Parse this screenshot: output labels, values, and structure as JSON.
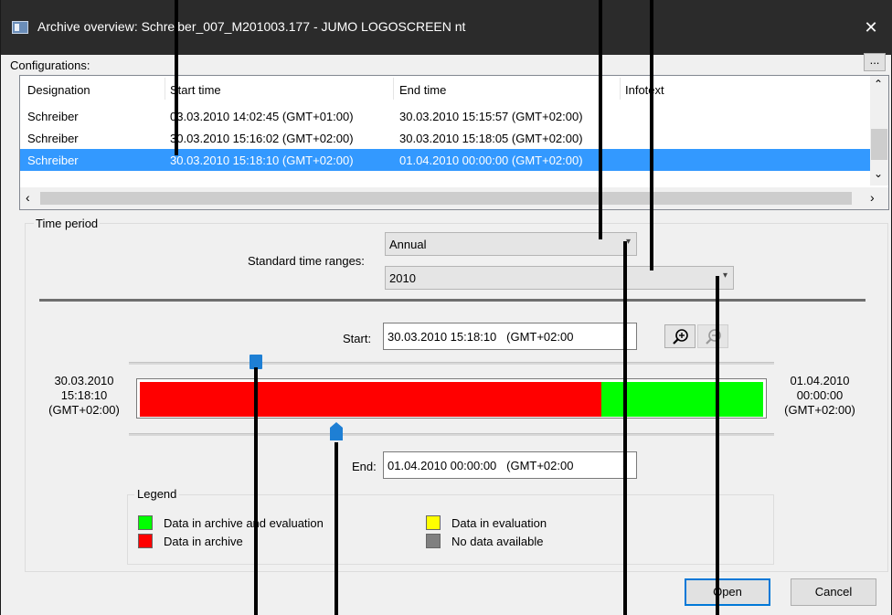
{
  "window": {
    "title": "Archive overview: Schreiber_007_M201003.177 - JUMO LOGOSCREEN nt",
    "close_glyph": "✕"
  },
  "configurations": {
    "label": "Configurations:",
    "more_button": "...",
    "columns": [
      "Designation",
      "Start time",
      "End time",
      "Infotext"
    ],
    "rows": [
      {
        "designation": "Schreiber",
        "start": "03.03.2010 14:02:45 (GMT+01:00)",
        "end": "30.03.2010 15:15:57 (GMT+02:00)",
        "info": ""
      },
      {
        "designation": "Schreiber",
        "start": "30.03.2010 15:16:02 (GMT+02:00)",
        "end": "30.03.2010 15:18:05 (GMT+02:00)",
        "info": ""
      },
      {
        "designation": "Schreiber",
        "start": "30.03.2010 15:18:10 (GMT+02:00)",
        "end": "01.04.2010 00:00:00 (GMT+02:00)",
        "info": ""
      }
    ],
    "selected_row": 2
  },
  "time_period": {
    "group_title": "Time period",
    "standard_ranges_label": "Standard time ranges:",
    "range_value": "Annual",
    "year_value": "2010",
    "start_label": "Start:",
    "start_value": "30.03.2010 15:18:10",
    "start_tz": "(GMT+02:00",
    "end_label": "End:",
    "end_value": "01.04.2010 00:00:00",
    "end_tz": "(GMT+02:00",
    "left_edge": [
      "30.03.2010",
      "15:18:10",
      "(GMT+02:00)"
    ],
    "right_edge": [
      "01.04.2010",
      "00:00:00",
      "(GMT+02:00)"
    ],
    "timeline_segments": [
      {
        "state": "archive",
        "from": 0.0,
        "to": 0.74,
        "color": "#ff0000"
      },
      {
        "state": "archive_and_evaluation",
        "from": 0.74,
        "to": 1.0,
        "color": "#00ff00"
      }
    ],
    "start_thumb_fraction": 0.19,
    "end_thumb_fraction": 0.32
  },
  "legend": {
    "title": "Legend",
    "items": [
      {
        "label": "Data in archive and evaluation",
        "color": "#00ff00"
      },
      {
        "label": "Data in archive",
        "color": "#ff0000"
      },
      {
        "label": "Data in evaluation",
        "color": "#ffff00"
      },
      {
        "label": "No data available",
        "color": "#808080"
      }
    ]
  },
  "buttons": {
    "open": "Open",
    "cancel": "Cancel"
  },
  "icons": {
    "app": "app-window-icon",
    "zoom_in": "zoom-in-icon",
    "zoom_out": "zoom-out-icon"
  }
}
